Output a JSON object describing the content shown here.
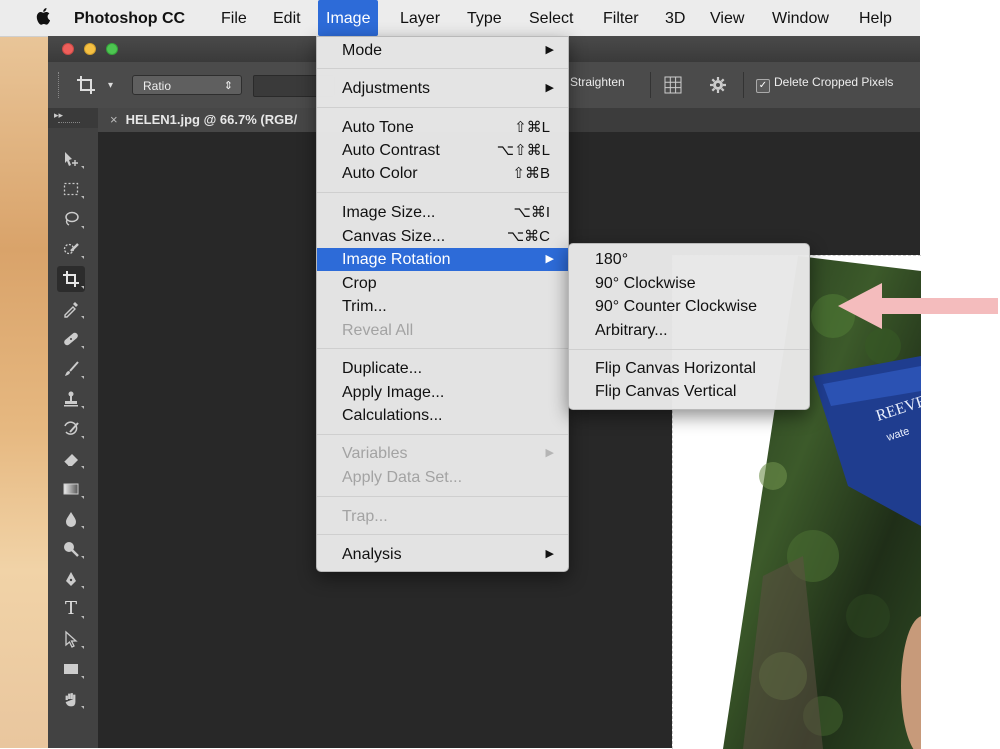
{
  "menubar": {
    "app_name": "Photoshop CC",
    "items": [
      "File",
      "Edit",
      "Image",
      "Layer",
      "Type",
      "Select",
      "Filter",
      "3D",
      "View",
      "Window",
      "Help"
    ]
  },
  "options_bar": {
    "ratio_label": "Ratio",
    "straighten_label": "Straighten",
    "delete_cropped_label": "Delete Cropped Pixels",
    "delete_cropped_checked": true
  },
  "document_tab": {
    "title": "HELEN1.jpg @ 66.7% (RGB/"
  },
  "image_menu": {
    "items": [
      {
        "label": "Mode",
        "submenu": true
      },
      {
        "label": "Adjustments",
        "submenu": true
      },
      {
        "label": "Auto Tone",
        "shortcut": "⇧⌘L"
      },
      {
        "label": "Auto Contrast",
        "shortcut": "⌥⇧⌘L"
      },
      {
        "label": "Auto Color",
        "shortcut": "⇧⌘B"
      },
      {
        "label": "Image Size...",
        "shortcut": "⌥⌘I"
      },
      {
        "label": "Canvas Size...",
        "shortcut": "⌥⌘C"
      },
      {
        "label": "Image Rotation",
        "submenu": true,
        "highlighted": true
      },
      {
        "label": "Crop"
      },
      {
        "label": "Trim..."
      },
      {
        "label": "Reveal All",
        "disabled": true
      },
      {
        "label": "Duplicate..."
      },
      {
        "label": "Apply Image..."
      },
      {
        "label": "Calculations..."
      },
      {
        "label": "Variables",
        "submenu": true,
        "disabled": true
      },
      {
        "label": "Apply Data Set...",
        "disabled": true
      },
      {
        "label": "Trap...",
        "disabled": true
      },
      {
        "label": "Analysis",
        "submenu": true
      }
    ]
  },
  "rotation_menu": {
    "items": [
      {
        "label": "180°"
      },
      {
        "label": "90° Clockwise"
      },
      {
        "label": "90° Counter Clockwise"
      },
      {
        "label": "Arbitrary..."
      },
      {
        "label": "Flip Canvas Horizontal"
      },
      {
        "label": "Flip Canvas Vertical"
      }
    ]
  },
  "colors": {
    "menu_highlight": "#2d6bd8",
    "annotation_arrow": "#f4bcbd"
  }
}
